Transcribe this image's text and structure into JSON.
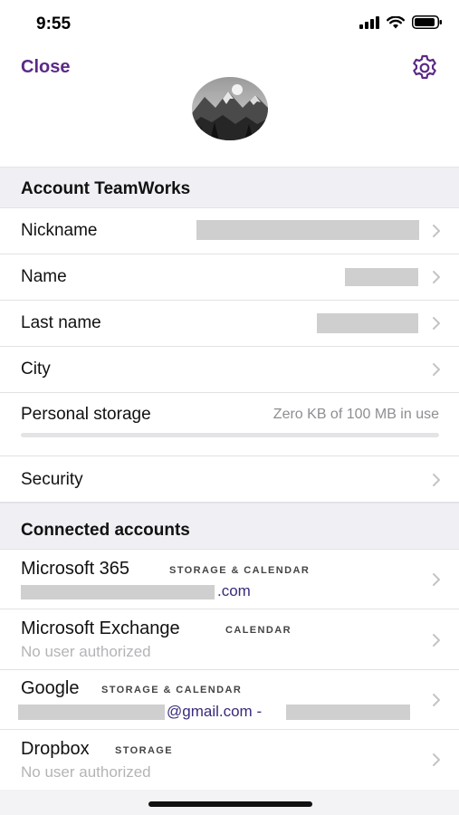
{
  "status_bar": {
    "time": "9:55"
  },
  "nav": {
    "close_label": "Close"
  },
  "account_section": {
    "header": "Account TeamWorks"
  },
  "profile_rows": {
    "nickname": "Nickname",
    "name": "Name",
    "last_name": "Last name",
    "city": "City",
    "personal_storage": "Personal storage",
    "storage_value": "Zero KB of 100 MB in use",
    "storage_fraction": 0,
    "security": "Security"
  },
  "connected_section": {
    "header": "Connected accounts"
  },
  "accounts": [
    {
      "name": "Microsoft 365",
      "tag": "STORAGE & CALENDAR",
      "detail": ".com"
    },
    {
      "name": "Microsoft Exchange",
      "tag": "CALENDAR",
      "detail": "No user authorized"
    },
    {
      "name": "Google",
      "tag": "STORAGE & CALENDAR",
      "detail": "@gmail.com -"
    },
    {
      "name": "Dropbox",
      "tag": "STORAGE",
      "detail": "No user authorized"
    }
  ],
  "colors": {
    "accent": "#5b2a86",
    "section_bg": "#efeff4",
    "redaction": "#cfcfcf"
  }
}
